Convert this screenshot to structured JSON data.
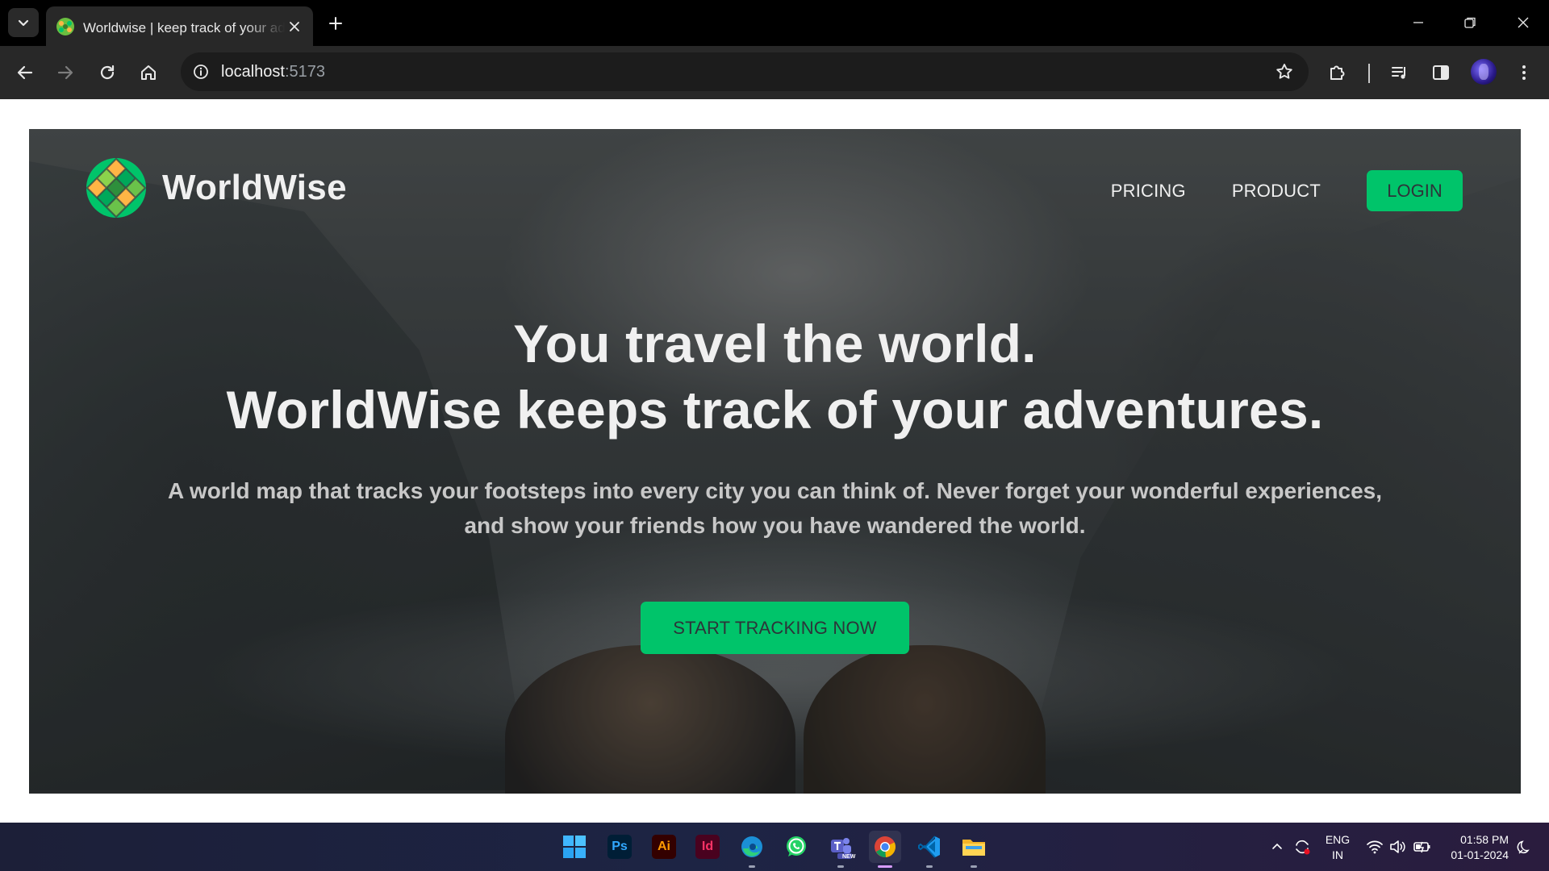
{
  "browser": {
    "tab": {
      "title": "Worldwise | keep track of your adventures"
    },
    "address": {
      "host": "localhost",
      "port": ":5173"
    }
  },
  "page": {
    "brand": "WorldWise",
    "nav": {
      "pricing": "PRICING",
      "product": "PRODUCT",
      "login": "LOGIN"
    },
    "headline_line1": "You travel the world.",
    "headline_line2": "WorldWise keeps track of your adventures.",
    "subtitle": "A world map that tracks your footsteps into every city you can think of. Never forget your wonderful experiences, and show your friends how you have wandered the world.",
    "cta": "START TRACKING NOW",
    "colors": {
      "accent": "#00c46a",
      "hero_text": "#f0f0f0",
      "button_text": "#2d3439"
    }
  },
  "taskbar": {
    "apps": [
      "windows-start",
      "photoshop",
      "illustrator",
      "indesign",
      "edge-canary",
      "whatsapp",
      "teams",
      "chrome",
      "vscode",
      "file-explorer"
    ],
    "app_labels": {
      "photoshop": "Ps",
      "illustrator": "Ai",
      "indesign": "Id",
      "teams_badge": "NEW"
    },
    "language": {
      "line1": "ENG",
      "line2": "IN"
    },
    "clock": {
      "time": "01:58 PM",
      "date": "01-01-2024"
    }
  }
}
